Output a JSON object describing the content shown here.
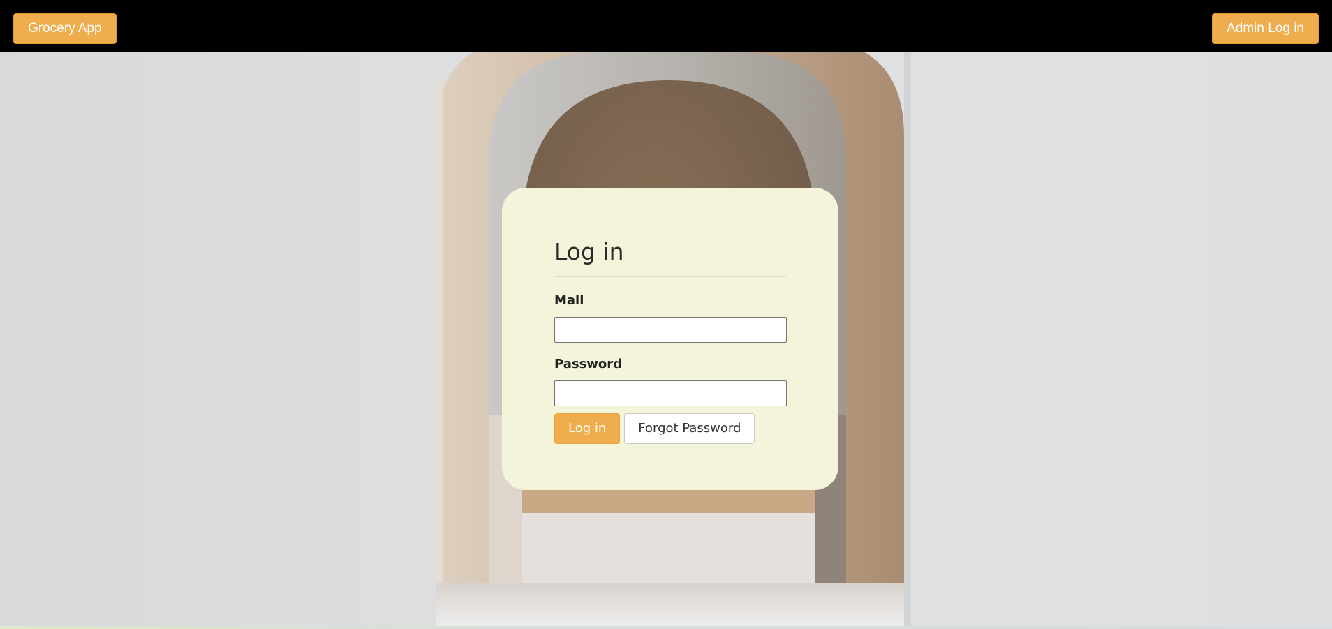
{
  "navbar": {
    "brand_label": "Grocery App",
    "admin_login_label": "Admin Log in"
  },
  "login": {
    "title": "Log in",
    "mail_label": "Mail",
    "mail_value": "",
    "password_label": "Password",
    "password_value": "",
    "submit_label": "Log in",
    "forgot_label": "Forgot Password"
  },
  "colors": {
    "accent": "#efad4e",
    "navbar_bg": "#000000",
    "card_bg": "#f4f4da"
  }
}
